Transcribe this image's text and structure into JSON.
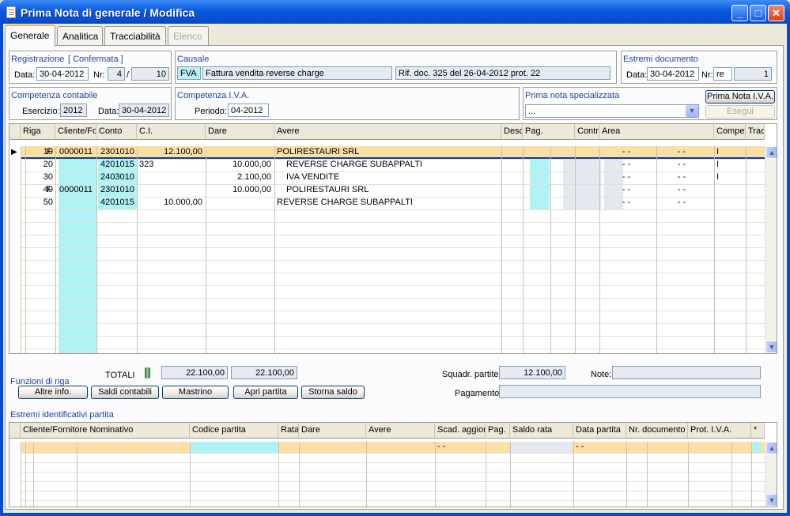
{
  "window": {
    "title": "Prima Nota di generale / Modifica"
  },
  "tabs": [
    {
      "label": "Generale"
    },
    {
      "label": "Analitica"
    },
    {
      "label": "Tracciabilità"
    },
    {
      "label": "Elenco"
    }
  ],
  "registrazione": {
    "title": "Registrazione",
    "status": "[ Confermata ]",
    "data_label": "Data:",
    "data": "30-04-2012",
    "nr_label": "Nr:",
    "nr": "4",
    "sep": "/",
    "nr2": "10"
  },
  "causale": {
    "title": "Causale",
    "code": "FVA",
    "desc": "Fattura vendita reverse charge",
    "rif": "Rif. doc. 325 del 26-04-2012 prot. 22"
  },
  "estremi": {
    "title": "Estremi documento",
    "data_label": "Data:",
    "data": "30-04-2012",
    "nr_label": "Nr:",
    "nr": "re",
    "num": "1"
  },
  "competenza": {
    "title": "Competenza contabile",
    "esercizio_label": "Esercizio:",
    "esercizio": "2012",
    "data_label": "Data:",
    "data": "30-04-2012"
  },
  "iva": {
    "title": "Competenza I.V.A.",
    "periodo_label": "Periodo:",
    "periodo": "04-2012"
  },
  "specializzata": {
    "title": "Prima nota specializzata",
    "value": "...",
    "btn_iva": "Prima Nota I.V.A.",
    "btn_esegui": "Esegui"
  },
  "grid": {
    "headers": [
      "Riga",
      "Cliente/Fornit.",
      "Conto",
      "C.I.",
      "Dare",
      "Avere",
      "Descrizione",
      "Pag.",
      "Contropartita",
      "Area",
      "Competenza",
      "Traccia"
    ],
    "rows": [
      {
        "riga": "10",
        "cf": "F",
        "cliente": "0000011",
        "conto": "2301010",
        "ci": "",
        "dare": "12.100,00",
        "avere": "",
        "desc": "POLIRESTAURI SRL",
        "comp1": "- -",
        "comp2": "- -",
        "traccia": "I"
      },
      {
        "riga": "20",
        "cf": "",
        "cliente": "",
        "conto": "4201015",
        "ci": "323",
        "dare": "",
        "avere": "10.000,00",
        "desc": "REVERSE CHARGE SUBAPPALTI",
        "comp1": "- -",
        "comp2": "- -",
        "traccia": "I"
      },
      {
        "riga": "30",
        "cf": "",
        "cliente": "",
        "conto": "2403010",
        "ci": "",
        "dare": "",
        "avere": "2.100,00",
        "desc": "IVA VENDITE",
        "comp1": "- -",
        "comp2": "- -",
        "traccia": "I"
      },
      {
        "riga": "40",
        "cf": "F",
        "cliente": "0000011",
        "conto": "2301010",
        "ci": "",
        "dare": "",
        "avere": "10.000,00",
        "desc": "POLIRESTAURI SRL",
        "comp1": "- -",
        "comp2": "- -",
        "traccia": ""
      },
      {
        "riga": "50",
        "cf": "",
        "cliente": "",
        "conto": "4201015",
        "ci": "",
        "dare": "10.000,00",
        "avere": "",
        "desc": "REVERSE CHARGE SUBAPPALTI",
        "comp1": "- -",
        "comp2": "- -",
        "traccia": ""
      }
    ]
  },
  "funzioni": {
    "title": "Funzioni di riga",
    "totali_label": "TOTALI",
    "tot_dare": "22.100,00",
    "tot_avere": "22.100,00",
    "squadr_label": "Squadr. partite:",
    "squadr": "12.100,00",
    "note_label": "Note:",
    "pagamento_label": "Pagamento:",
    "buttons": [
      "Altre info.",
      "Saldi contabili",
      "Mastrino",
      "Apri partita",
      "Storna saldo"
    ]
  },
  "partita": {
    "title": "Estremi identificativi partita",
    "headers": [
      "Cliente/Fornitore Nominativo",
      "Codice partita",
      "Rata",
      "Dare",
      "Avere",
      "Scad. aggior.",
      "Pag.",
      "Saldo rata",
      "Data  partita",
      "Nr. documento",
      "Prot. I.V.A.",
      "*"
    ],
    "row": {
      "scad": "- -",
      "data": "- -"
    }
  },
  "colors": {
    "highlight": "#FCDFA4",
    "cyan": "#AFF3F4",
    "accent": "#1D43A6"
  }
}
